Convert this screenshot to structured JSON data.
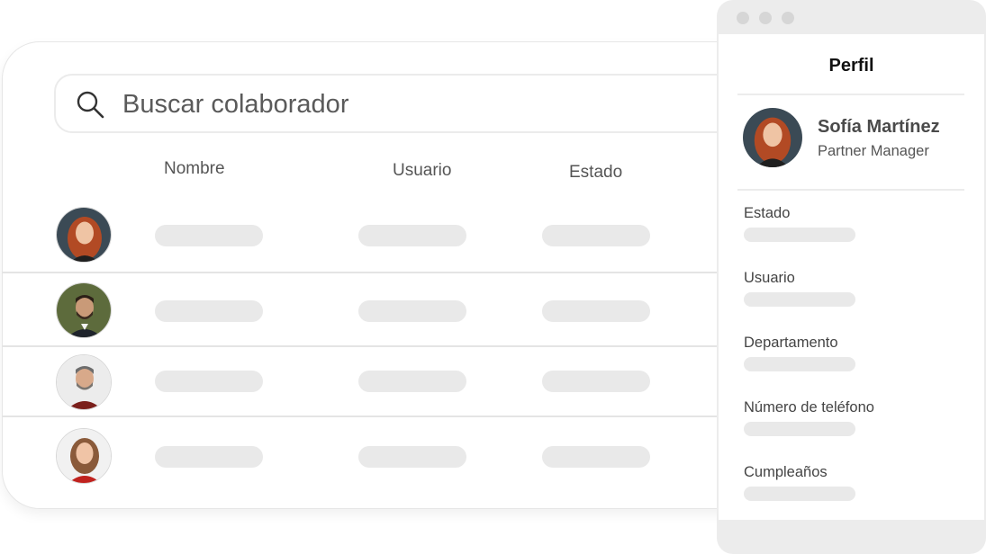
{
  "search": {
    "placeholder": "Buscar colaborador",
    "icon": "search-icon"
  },
  "table": {
    "columns": [
      "Nombre",
      "Usuario",
      "Estado"
    ],
    "rows": [
      {
        "avatar": "woman-red-hair-avatar"
      },
      {
        "avatar": "man-beard-suit-avatar"
      },
      {
        "avatar": "man-gray-hair-avatar"
      },
      {
        "avatar": "woman-red-top-avatar"
      }
    ]
  },
  "profile": {
    "title": "Perfil",
    "name": "Sofía Martínez",
    "role": "Partner Manager",
    "fields": [
      "Estado",
      "Usuario",
      "Departamento",
      "Número de teléfono",
      "Cumpleaños"
    ]
  },
  "colors": {
    "skeleton": "#e9e9e9",
    "window_chrome": "#ececec",
    "divider": "#e4e4e4"
  }
}
